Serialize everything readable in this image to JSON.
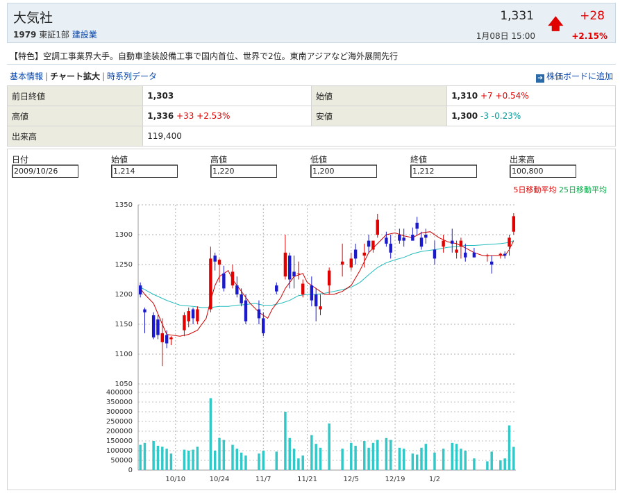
{
  "stock": {
    "name": "大気社",
    "code": "1979",
    "market": "東証1部",
    "sector": "建設業",
    "price": "1,331",
    "datetime": "1月08日 15:00",
    "change": "+28",
    "change_pct": "+2.15%",
    "up_arrow": "🡅"
  },
  "feature_text": "【特色】空調工事業界大手。自動車塗装設備工事で国内首位、世界で2位。東南アジアなど海外展開先行",
  "nav": {
    "basic_info": "基本情報",
    "chart_zoom": "チャート拡大",
    "time_series": "時系列データ",
    "add_board": "株価ボードに追加"
  },
  "info": {
    "prev_close_label": "前日終値",
    "prev_close": "1,303",
    "open_label": "始値",
    "open": "1,310",
    "open_chg": "+7",
    "open_pct": "+0.54%",
    "high_label": "高値",
    "high": "1,336",
    "high_chg": "+33",
    "high_pct": "+2.53%",
    "low_label": "安値",
    "low": "1,300",
    "low_chg": "-3",
    "low_pct": "-0.23%",
    "volume_label": "出来高",
    "volume": "119,400"
  },
  "ohlc": {
    "date_label": "日付",
    "date": "2009/10/26",
    "open_label": "始値",
    "open": "1,214",
    "high_label": "高値",
    "high": "1,220",
    "low_label": "低値",
    "low": "1,200",
    "close_label": "終値",
    "close": "1,212",
    "volume_label": "出来高",
    "volume": "100,800"
  },
  "legend": {
    "ma5": "5日移動平均",
    "ma25": "25日移動平均"
  },
  "colors": {
    "up": "#e00000",
    "down": "#1a1acc",
    "ma5": "#cc0000",
    "ma25": "#22bbbb",
    "volume": "#33c8c8"
  },
  "chart_data": {
    "type": "candlestick",
    "price_ticks": [
      1050,
      1100,
      1150,
      1200,
      1250,
      1300,
      1350
    ],
    "price_ylim": [
      1050,
      1350
    ],
    "volume_ticks": [
      0,
      50000,
      100000,
      150000,
      200000,
      250000,
      300000,
      350000,
      400000
    ],
    "volume_ylim": [
      0,
      400000
    ],
    "x_tick_labels": [
      {
        "index": 8,
        "label": "10/10"
      },
      {
        "index": 18,
        "label": "10/24"
      },
      {
        "index": 28,
        "label": "11/7"
      },
      {
        "index": 38,
        "label": "11/21"
      },
      {
        "index": 48,
        "label": "12/5"
      },
      {
        "index": 58,
        "label": "12/19"
      },
      {
        "index": 67,
        "label": "1/2"
      }
    ],
    "candles": [
      [
        1215,
        1220,
        1195,
        1200,
        130000
      ],
      [
        1175,
        1178,
        1135,
        1170,
        140000
      ],
      [
        1187,
        1190,
        1168,
        1168,
        0
      ],
      [
        1165,
        1170,
        1125,
        1128,
        150000
      ],
      [
        1158,
        1165,
        1125,
        1132,
        125000
      ],
      [
        1120,
        1160,
        1080,
        1135,
        120000
      ],
      [
        1132,
        1140,
        1110,
        1118,
        110000
      ],
      [
        1125,
        1130,
        1115,
        1128,
        85000
      ],
      [
        1128,
        1132,
        1125,
        1130,
        0
      ],
      [
        1128,
        1132,
        1125,
        1130,
        0
      ],
      [
        1140,
        1170,
        1130,
        1165,
        105000
      ],
      [
        1155,
        1178,
        1145,
        1172,
        100000
      ],
      [
        1175,
        1178,
        1150,
        1160,
        105000
      ],
      [
        1155,
        1180,
        1150,
        1175,
        120000
      ],
      [
        1180,
        1182,
        1170,
        1178,
        0
      ],
      [
        1175,
        1210,
        1165,
        1200,
        0
      ],
      [
        1175,
        1280,
        1170,
        1260,
        370000
      ],
      [
        1265,
        1270,
        1240,
        1255,
        100000
      ],
      [
        1250,
        1260,
        1220,
        1258,
        165000
      ],
      [
        1235,
        1248,
        1205,
        1210,
        155000
      ],
      [
        1220,
        1230,
        1210,
        1225,
        0
      ],
      [
        1215,
        1250,
        1210,
        1238,
        130000
      ],
      [
        1215,
        1230,
        1195,
        1200,
        110000
      ],
      [
        1200,
        1210,
        1180,
        1185,
        90000
      ],
      [
        1190,
        1200,
        1150,
        1155,
        75000
      ],
      [
        1180,
        1190,
        1170,
        1185,
        0
      ],
      [
        1175,
        1180,
        1160,
        1165,
        0
      ],
      [
        1175,
        1190,
        1150,
        1160,
        85000
      ],
      [
        1160,
        1170,
        1130,
        1135,
        100000
      ],
      [
        1150,
        1160,
        1140,
        1145,
        0
      ],
      [
        1180,
        1220,
        1170,
        1215,
        0
      ],
      [
        1215,
        1220,
        1200,
        1205,
        95000
      ],
      [
        1180,
        1180,
        1160,
        1165,
        0
      ],
      [
        1230,
        1300,
        1225,
        1270,
        300000
      ],
      [
        1265,
        1270,
        1210,
        1225,
        165000
      ],
      [
        1238,
        1265,
        1210,
        1230,
        110000
      ],
      [
        1235,
        1255,
        1225,
        1235,
        60000
      ],
      [
        1200,
        1225,
        1195,
        1218,
        75000
      ],
      [
        1190,
        1210,
        1175,
        1200,
        0
      ],
      [
        1215,
        1230,
        1180,
        1190,
        180000
      ],
      [
        1200,
        1210,
        1155,
        1180,
        135000
      ],
      [
        1175,
        1200,
        1165,
        1180,
        115000
      ],
      [
        1180,
        1195,
        1170,
        1185,
        0
      ],
      [
        1215,
        1245,
        1200,
        1240,
        240000
      ],
      [
        1190,
        1210,
        1160,
        1165,
        0
      ],
      [
        1205,
        1220,
        1195,
        1215,
        0
      ],
      [
        1250,
        1285,
        1230,
        1255,
        110000
      ],
      [
        1258,
        1270,
        1245,
        1250,
        0
      ],
      [
        1245,
        1270,
        1240,
        1260,
        140000
      ],
      [
        1275,
        1285,
        1250,
        1260,
        125000
      ],
      [
        1268,
        1300,
        1260,
        1290,
        0
      ],
      [
        1265,
        1285,
        1245,
        1270,
        150000
      ],
      [
        1290,
        1300,
        1270,
        1280,
        115000
      ],
      [
        1275,
        1290,
        1270,
        1290,
        140000
      ],
      [
        1300,
        1335,
        1295,
        1325,
        155000
      ],
      [
        1310,
        1325,
        1300,
        1305,
        0
      ],
      [
        1295,
        1305,
        1280,
        1285,
        165000
      ],
      [
        1285,
        1300,
        1260,
        1270,
        155000
      ],
      [
        1300,
        1315,
        1270,
        1280,
        0
      ],
      [
        1300,
        1310,
        1285,
        1290,
        115000
      ],
      [
        1295,
        1310,
        1280,
        1290,
        110000
      ],
      [
        1300,
        1318,
        1295,
        1310,
        0
      ],
      [
        1300,
        1312,
        1290,
        1290,
        85000
      ],
      [
        1320,
        1330,
        1300,
        1310,
        80000
      ],
      [
        1295,
        1305,
        1275,
        1280,
        115000
      ],
      [
        1300,
        1310,
        1285,
        1295,
        135000
      ],
      [
        1290,
        1295,
        1270,
        1282,
        0
      ],
      [
        1275,
        1290,
        1250,
        1260,
        90000
      ],
      [
        1275,
        1290,
        1250,
        1270,
        0
      ],
      [
        1280,
        1300,
        1270,
        1290,
        110000
      ],
      [
        1295,
        1305,
        1280,
        1290,
        0
      ],
      [
        1290,
        1310,
        1270,
        1285,
        140000
      ],
      [
        1270,
        1290,
        1260,
        1275,
        135000
      ],
      [
        1280,
        1295,
        1260,
        1290,
        110000
      ],
      [
        1270,
        1285,
        1255,
        1262,
        100000
      ],
      [
        1270,
        1275,
        1255,
        1265,
        0
      ],
      [
        1270,
        1278,
        1262,
        1262,
        60000
      ],
      [
        1265,
        1275,
        1240,
        1250,
        0
      ],
      [
        1250,
        1268,
        1245,
        1262,
        0
      ],
      [
        1265,
        1268,
        1255,
        1265,
        45000
      ],
      [
        1255,
        1265,
        1235,
        1250,
        95000
      ],
      [
        1262,
        1270,
        1245,
        1262,
        0
      ],
      [
        1266,
        1270,
        1260,
        1268,
        50000
      ],
      [
        1268,
        1272,
        1260,
        1265,
        60000
      ],
      [
        1280,
        1300,
        1265,
        1295,
        230000
      ],
      [
        1305,
        1336,
        1300,
        1331,
        119400
      ]
    ],
    "ma5": [
      [
        0,
        1210
      ],
      [
        1,
        1200
      ],
      [
        3,
        1185
      ],
      [
        5,
        1150
      ],
      [
        6,
        1133
      ],
      [
        9,
        1130
      ],
      [
        11,
        1133
      ],
      [
        13,
        1140
      ],
      [
        15,
        1160
      ],
      [
        16,
        1190
      ],
      [
        17,
        1215
      ],
      [
        18,
        1230
      ],
      [
        20,
        1240
      ],
      [
        21,
        1225
      ],
      [
        22,
        1215
      ],
      [
        23,
        1205
      ],
      [
        25,
        1185
      ],
      [
        27,
        1170
      ],
      [
        29,
        1160
      ],
      [
        30,
        1175
      ],
      [
        31,
        1185
      ],
      [
        32,
        1195
      ],
      [
        33,
        1210
      ],
      [
        35,
        1230
      ],
      [
        37,
        1235
      ],
      [
        38,
        1220
      ],
      [
        40,
        1210
      ],
      [
        42,
        1200
      ],
      [
        44,
        1200
      ],
      [
        46,
        1205
      ],
      [
        48,
        1215
      ],
      [
        50,
        1240
      ],
      [
        52,
        1270
      ],
      [
        54,
        1285
      ],
      [
        56,
        1300
      ],
      [
        58,
        1303
      ],
      [
        60,
        1298
      ],
      [
        62,
        1295
      ],
      [
        64,
        1303
      ],
      [
        66,
        1305
      ],
      [
        68,
        1295
      ],
      [
        70,
        1288
      ],
      [
        72,
        1285
      ],
      [
        74,
        1278
      ],
      [
        76,
        1270
      ],
      [
        78,
        1265
      ],
      [
        80,
        1265
      ],
      [
        82,
        1265
      ],
      [
        83,
        1265
      ],
      [
        84,
        1275
      ],
      [
        85,
        1290
      ]
    ],
    "ma25": [
      [
        0,
        1212
      ],
      [
        3,
        1200
      ],
      [
        6,
        1190
      ],
      [
        9,
        1182
      ],
      [
        12,
        1180
      ],
      [
        14,
        1178
      ],
      [
        16,
        1178
      ],
      [
        18,
        1180
      ],
      [
        20,
        1180
      ],
      [
        22,
        1182
      ],
      [
        24,
        1183
      ],
      [
        26,
        1185
      ],
      [
        28,
        1182
      ],
      [
        30,
        1182
      ],
      [
        32,
        1185
      ],
      [
        34,
        1190
      ],
      [
        36,
        1198
      ],
      [
        38,
        1200
      ],
      [
        40,
        1200
      ],
      [
        42,
        1202
      ],
      [
        44,
        1205
      ],
      [
        46,
        1208
      ],
      [
        48,
        1212
      ],
      [
        50,
        1220
      ],
      [
        52,
        1233
      ],
      [
        54,
        1245
      ],
      [
        56,
        1253
      ],
      [
        58,
        1258
      ],
      [
        60,
        1262
      ],
      [
        62,
        1268
      ],
      [
        64,
        1272
      ],
      [
        66,
        1274
      ],
      [
        68,
        1276
      ],
      [
        70,
        1279
      ],
      [
        72,
        1280
      ],
      [
        74,
        1282
      ],
      [
        76,
        1282
      ],
      [
        78,
        1283
      ],
      [
        80,
        1284
      ],
      [
        82,
        1285
      ],
      [
        84,
        1287
      ],
      [
        85,
        1290
      ]
    ]
  }
}
